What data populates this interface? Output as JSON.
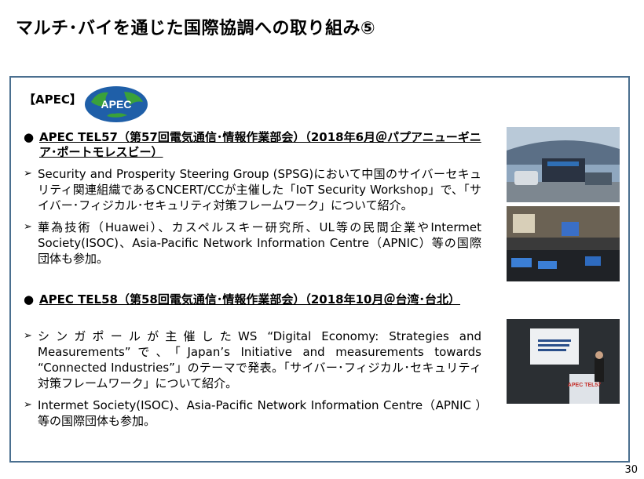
{
  "title": "マルチ･バイを通じた国際協調への取り組み⑤",
  "section_label": "【APEC】",
  "logo_text": "APEC",
  "meeting1": {
    "heading": "APEC TEL57（第57回電気通信･情報作業部会）（2018年6月＠パプアニューギニア･ポートモレスビー）",
    "items": [
      "Security and Prosperity Steering Group (SPSG)において中国のサイバーセキュリティ関連組織であるCNCERT/CCが主催した「IoT Security Workshop」で、「サイバー･フィジカル･セキュリティ対策フレームワーク」について紹介。",
      "華為技術（Huawei）、カスペルスキー研究所、UL等の民間企業やIntermet Society(ISOC)、Asia-Pacific Network Information Centre（APNIC）等の国際団体も参加。"
    ]
  },
  "meeting2": {
    "heading": "APEC TEL58（第58回電気通信･情報作業部会）（2018年10月＠台湾･台北）",
    "items": [
      "シンガポールが主催したWS “Digital Economy: Strategies and Measurements”で、「Japan’s Initiative and measurements towards “Connected Industries”」のテーマで発表。「サイバー･フィジカル･セキュリティ対策フレームワーク」について紹介。",
      "Intermet Society(ISOC)、Asia-Pacific Network Information Centre（APNIC ）等の国際団体も参加。"
    ]
  },
  "bullet_symbol": "●",
  "arrow_symbol": "➢",
  "page_number": "30",
  "photo3_sign": "APEC TEL57",
  "colors": {
    "frame": "#4a6f8f",
    "logo_blue": "#1f5fa8",
    "logo_green": "#3aa13a"
  }
}
